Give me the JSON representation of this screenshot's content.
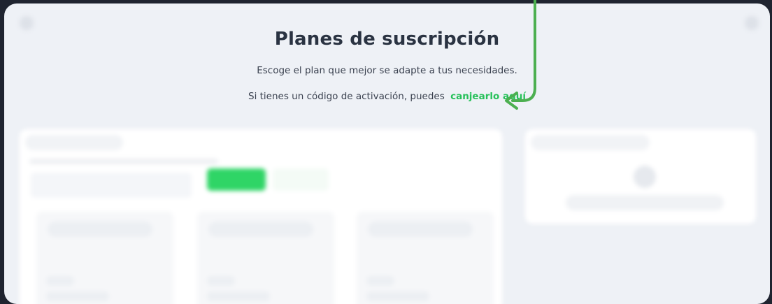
{
  "header": {
    "title": "Planes de suscripción",
    "subtitle": "Escoge el plan que mejor se adapte a tus necesidades.",
    "activation_text": "Si tienes un código de activación, puedes",
    "activation_link": "canjearlo aquí"
  },
  "colors": {
    "accent_green": "#27c15a",
    "arrow_green": "#4caf50",
    "title_color": "#2a3342"
  },
  "icons": {
    "left_corner": "menu-icon",
    "right_corner": "user-icon",
    "annotation": "arrow-pointer-icon"
  }
}
